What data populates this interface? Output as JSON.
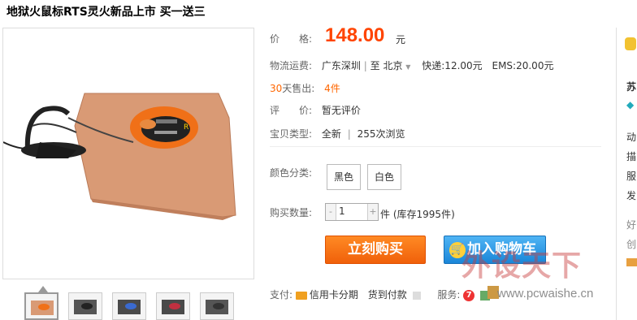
{
  "product": {
    "title": "地狱火鼠标RTS灵火新品上市 买一送三"
  },
  "price": {
    "label": "价　　格:",
    "value": "148.00",
    "unit": "元"
  },
  "shipping": {
    "label": "物流运费:",
    "from": "广东深圳",
    "sep": "|",
    "to_prefix": "至",
    "to": "北京",
    "express": "快递:12.00元",
    "ems": "EMS:20.00元"
  },
  "sales": {
    "label_num": "30",
    "label_text": "天售出:",
    "value": "4件"
  },
  "review": {
    "label": "评　　价:",
    "value": "暂无评价"
  },
  "item_type": {
    "label": "宝贝类型:",
    "condition": "全新",
    "sep": "|",
    "views": "255次浏览"
  },
  "color": {
    "label": "颜色分类:",
    "options": [
      "黑色",
      "白色"
    ]
  },
  "quantity": {
    "label": "购买数量:",
    "minus": "-",
    "value": "1",
    "plus": "+",
    "unit": "件",
    "stock": "(库存1995件)"
  },
  "actions": {
    "buy": "立刻购买",
    "cart": "加入购物车"
  },
  "payment": {
    "label": "支付:",
    "credit": "信用卡分期",
    "cod": "货到付款"
  },
  "service": {
    "label": "服务:",
    "seven_day": "7"
  },
  "right_bar": {
    "items": [
      "苏",
      "动",
      "描",
      "服",
      "发",
      "好",
      "创"
    ]
  },
  "watermark": {
    "text": "外设天下",
    "url": "www.pcwaishe.cn"
  },
  "colors": {
    "price": "#ff4400",
    "buy": "#f36b10",
    "cart": "#2b96e3"
  }
}
